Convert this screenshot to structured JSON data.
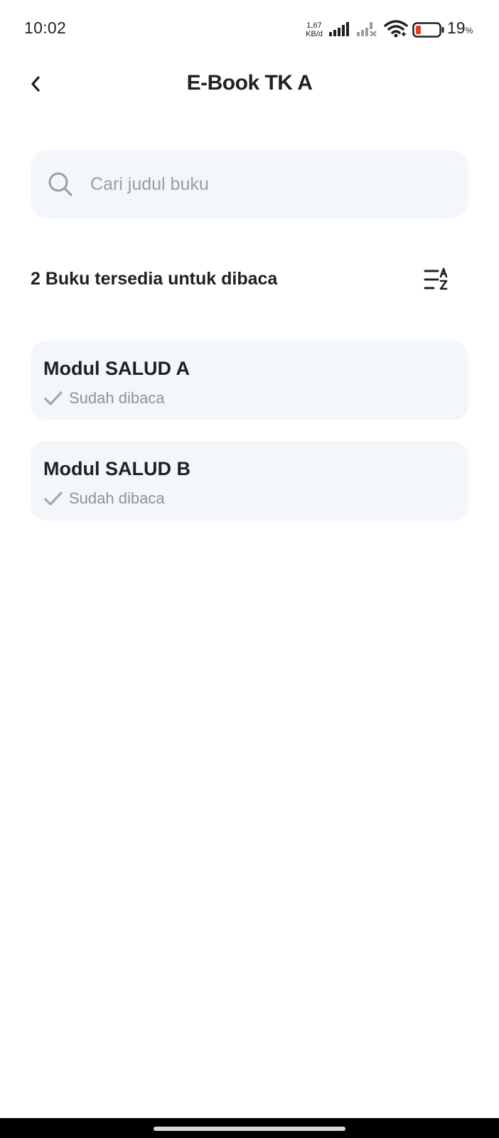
{
  "status_bar": {
    "time": "10:02",
    "net_speed_value": "1,67",
    "net_speed_unit": "KB/d",
    "battery_percent": "19",
    "battery_percent_sign": "%",
    "battery_color": "#e53935"
  },
  "header": {
    "back_icon": "chevron-left-icon",
    "title": "E-Book TK A"
  },
  "search": {
    "placeholder": "Cari judul buku",
    "value": ""
  },
  "list_header": {
    "count_label": "2 Buku tersedia untuk dibaca",
    "sort_icon": "sort-alpha-icon"
  },
  "books": [
    {
      "title": "Modul SALUD A",
      "status": "Sudah dibaca"
    },
    {
      "title": "Modul SALUD B",
      "status": "Sudah dibaca"
    }
  ],
  "colors": {
    "card_background": "#f3f6fb",
    "text_primary": "#1f2024",
    "text_muted": "#8f939b"
  }
}
